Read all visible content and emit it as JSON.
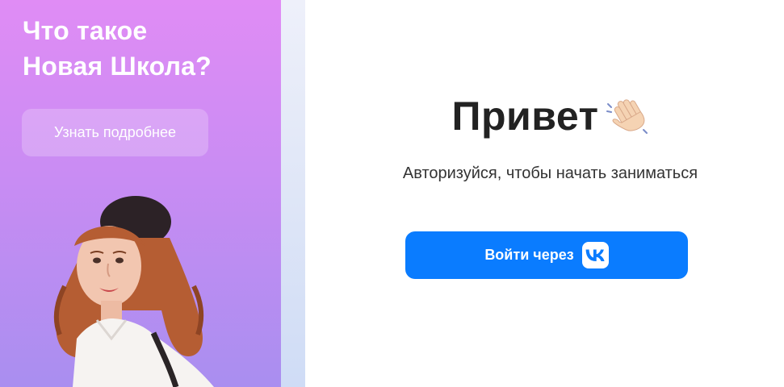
{
  "promo": {
    "title_line1": "Что такое",
    "title_line2": "Новая Школа?",
    "learn_more_label": "Узнать подробнее"
  },
  "login": {
    "greeting": "Привет",
    "subtitle": "Авторизуйся, чтобы начать заниматься",
    "vk_button_label": "Войти через",
    "vk_logo_text": "VK"
  },
  "colors": {
    "promo_gradient_top": "#e08cf5",
    "promo_gradient_bottom": "#a98ef0",
    "vk_button": "#0a7cff",
    "text_dark": "#222222"
  },
  "icons": {
    "greeting_icon": "waving-hand-icon",
    "vk_icon": "vk-logo-icon"
  }
}
